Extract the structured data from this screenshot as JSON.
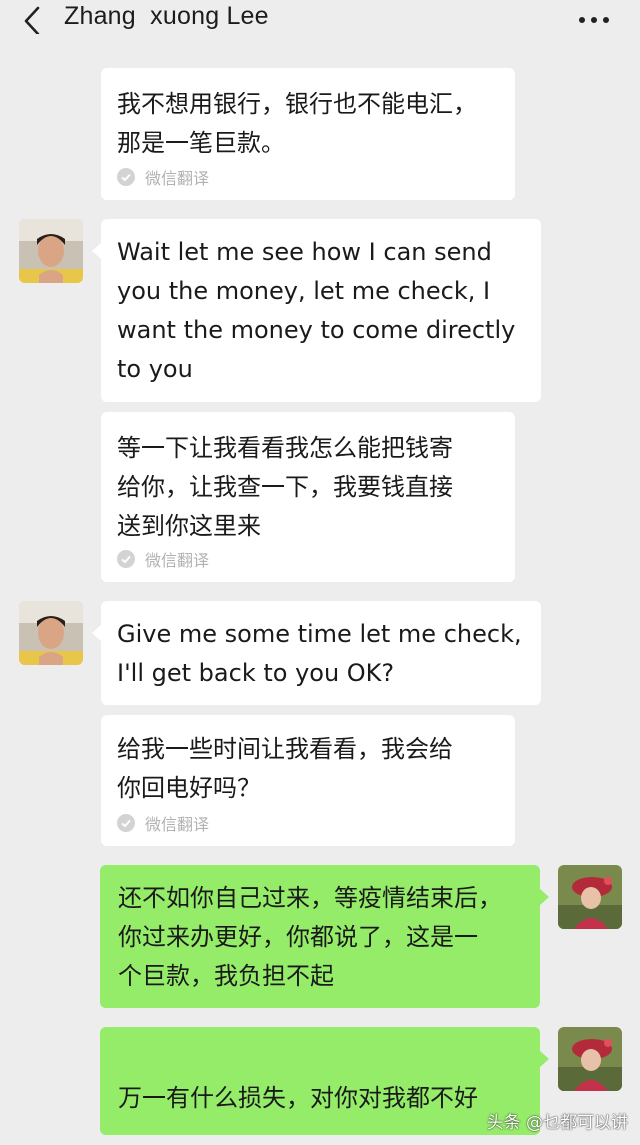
{
  "header": {
    "title": "Zhang  xuong Lee"
  },
  "messages": [
    {
      "text": "我不想用银行，银行也不能电汇，\n那是一笔巨款。",
      "translated_label": "微信翻译"
    },
    {
      "text": "Wait let me see how I can send\nyou the money, let me check, I\nwant the money to come directly\nto you"
    },
    {
      "text": "等一下让我看看我怎么能把钱寄\n给你，让我查一下，我要钱直接\n送到你这里来",
      "translated_label": "微信翻译"
    },
    {
      "text": "Give me some time let me check,\nI'll get back to you OK?"
    },
    {
      "text": "给我一些时间让我看看，我会给\n你回电好吗？",
      "translated_label": "微信翻译"
    },
    {
      "text": "还不如你自己过来，等疫情结束后，\n你过来办更好，你都说了，这是一\n个巨款，我负担不起"
    },
    {
      "text": "万一有什么损失，对你对我都不好"
    }
  ],
  "watermark": "头条 @乜都可以讲",
  "colors": {
    "background": "#ededed",
    "incoming_bubble": "#ffffff",
    "outgoing_bubble": "#95ec69",
    "translation_label": "#b2b2b2"
  },
  "icons": {
    "back": "chevron-left-icon",
    "more": "more-dots-icon",
    "translation": "check-circle-icon"
  }
}
